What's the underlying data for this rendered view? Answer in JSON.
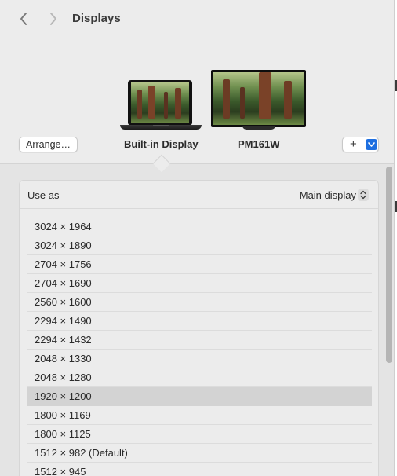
{
  "window": {
    "title": "Displays"
  },
  "toolbar": {
    "back_icon": "chevron-left-icon",
    "forward_icon": "chevron-right-icon"
  },
  "displays": [
    {
      "label": "Built-in Display",
      "type": "laptop",
      "selected": true
    },
    {
      "label": "PM161W",
      "type": "monitor",
      "selected": false
    }
  ],
  "buttons": {
    "arrange": "Arrange…",
    "add": "+",
    "add_menu_icon": "chevron-down-icon"
  },
  "use_as": {
    "label": "Use as",
    "value": "Main display"
  },
  "resolutions": [
    {
      "label": "3024 × 1964",
      "selected": false
    },
    {
      "label": "3024 × 1890",
      "selected": false
    },
    {
      "label": "2704 × 1756",
      "selected": false
    },
    {
      "label": "2704 × 1690",
      "selected": false
    },
    {
      "label": "2560 × 1600",
      "selected": false
    },
    {
      "label": "2294 × 1490",
      "selected": false
    },
    {
      "label": "2294 × 1432",
      "selected": false
    },
    {
      "label": "2048 × 1330",
      "selected": false
    },
    {
      "label": "2048 × 1280",
      "selected": false
    },
    {
      "label": "1920 × 1200",
      "selected": true
    },
    {
      "label": "1800 × 1169",
      "selected": false
    },
    {
      "label": "1800 × 1125",
      "selected": false
    },
    {
      "label": "1512 × 982 (Default)",
      "selected": false
    },
    {
      "label": "1512 × 945",
      "selected": false
    }
  ],
  "colors": {
    "accent": "#1e6fe0",
    "selected_row": "#d3d3d3",
    "window_bg": "#ececec"
  }
}
